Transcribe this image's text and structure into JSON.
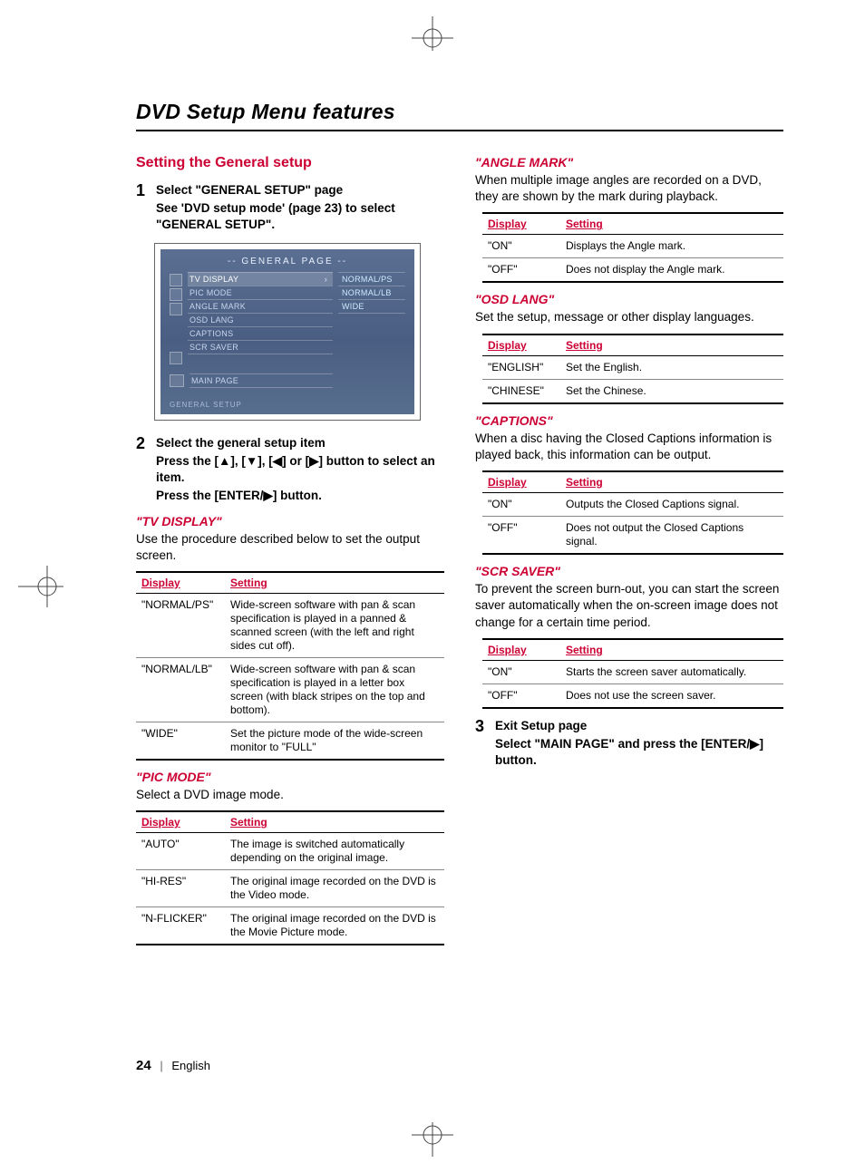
{
  "page_title": "DVD Setup Menu features",
  "section_heading": "Setting the General setup",
  "footer": {
    "page_number": "24",
    "language": "English"
  },
  "steps": {
    "one_num": "1",
    "one_lead": "Select \"GENERAL SETUP\" page",
    "one_detail": "See 'DVD setup mode' (page 23) to select \"GENERAL SETUP\".",
    "two_num": "2",
    "two_lead": "Select the general setup item",
    "two_detail_a": "Press the [▲], [▼], [◀] or [▶] button to select an item.",
    "two_detail_b": "Press the [ENTER/▶] button.",
    "three_num": "3",
    "three_lead": "Exit Setup page",
    "three_detail": "Select \"MAIN PAGE\" and press the [ENTER/▶] button."
  },
  "osd": {
    "title": "--  GENERAL PAGE  --",
    "items": [
      "TV DISPLAY",
      "PIC MODE",
      "ANGLE MARK",
      "OSD LANG",
      "CAPTIONS",
      "SCR SAVER"
    ],
    "subitems": [
      "NORMAL/PS",
      "NORMAL/LB",
      "WIDE"
    ],
    "main": "MAIN PAGE",
    "bottom": "GENERAL SETUP"
  },
  "features": {
    "tv_display": {
      "title": "\"TV DISPLAY\"",
      "desc": "Use the procedure described below to set the output screen.",
      "headers": {
        "display": "Display",
        "setting": "Setting"
      },
      "rows": [
        {
          "display": "\"NORMAL/PS\"",
          "setting": "Wide-screen software with pan & scan specification is played in a panned & scanned screen (with the left and right sides cut off)."
        },
        {
          "display": "\"NORMAL/LB\"",
          "setting": "Wide-screen software with pan & scan specification is played in a letter box screen (with black stripes on the top and bottom)."
        },
        {
          "display": "\"WIDE\"",
          "setting": "Set the picture mode of the wide-screen monitor to \"FULL\""
        }
      ]
    },
    "pic_mode": {
      "title": "\"PIC MODE\"",
      "desc": "Select a DVD image mode.",
      "headers": {
        "display": "Display",
        "setting": "Setting"
      },
      "rows": [
        {
          "display": "\"AUTO\"",
          "setting": "The image is switched automatically depending on the original image."
        },
        {
          "display": "\"HI-RES\"",
          "setting": "The original image recorded on the DVD is the Video mode."
        },
        {
          "display": "\"N-FLICKER\"",
          "setting": "The original image recorded on the DVD is the Movie Picture mode."
        }
      ]
    },
    "angle_mark": {
      "title": "\"ANGLE MARK\"",
      "desc": "When multiple image angles are recorded on a DVD, they are shown by the mark during playback.",
      "headers": {
        "display": "Display",
        "setting": "Setting"
      },
      "rows": [
        {
          "display": "\"ON\"",
          "setting": "Displays the Angle mark."
        },
        {
          "display": "\"OFF\"",
          "setting": "Does not display the Angle mark."
        }
      ]
    },
    "osd_lang": {
      "title": "\"OSD LANG\"",
      "desc": "Set the setup, message or other display languages.",
      "headers": {
        "display": "Display",
        "setting": "Setting"
      },
      "rows": [
        {
          "display": "\"ENGLISH\"",
          "setting": "Set the English."
        },
        {
          "display": "\"CHINESE\"",
          "setting": "Set the Chinese."
        }
      ]
    },
    "captions": {
      "title": "\"CAPTIONS\"",
      "desc": "When a disc having the Closed Captions information is played back, this information can be output.",
      "headers": {
        "display": "Display",
        "setting": "Setting"
      },
      "rows": [
        {
          "display": "\"ON\"",
          "setting": "Outputs the Closed Captions signal."
        },
        {
          "display": "\"OFF\"",
          "setting": "Does not output the Closed Captions signal."
        }
      ]
    },
    "scr_saver": {
      "title": "\"SCR SAVER\"",
      "desc": "To prevent the screen burn-out, you can start the screen saver automatically when the on-screen image does not change for a certain time period.",
      "headers": {
        "display": "Display",
        "setting": "Setting"
      },
      "rows": [
        {
          "display": "\"ON\"",
          "setting": "Starts the screen saver automatically."
        },
        {
          "display": "\"OFF\"",
          "setting": "Does not use the screen saver."
        }
      ]
    }
  }
}
